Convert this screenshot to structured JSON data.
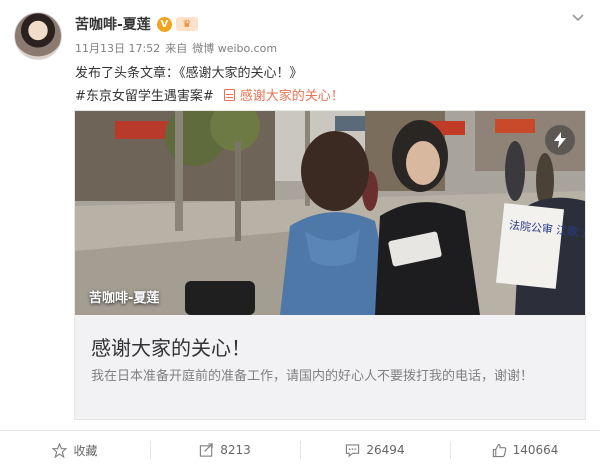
{
  "user": {
    "name": "苦咖啡-夏莲",
    "verified_badge": "V",
    "level_badge": "♛"
  },
  "meta": {
    "time": "11月13日 17:52",
    "from_label": "来自",
    "source": "微博 weibo.com"
  },
  "post": {
    "text": "发布了头条文章：《感谢大家的关心！》",
    "hashtag": "#东京女留学生遇害案#",
    "article_link": "感谢大家的关心！"
  },
  "card": {
    "watermark": "苦咖啡-夏莲",
    "title": "感谢大家的关心！",
    "summary": "我在日本准备开庭前的准备工作，请国内的好心人不要拨打我的电话，谢谢！",
    "sign_text": "法院公审 江歌 刘鑫"
  },
  "actions": {
    "favorite": "收藏",
    "repost": "8213",
    "comment": "26494",
    "like": "140664"
  },
  "colors": {
    "link": "#eb7350",
    "badge": "#f0a51c"
  }
}
